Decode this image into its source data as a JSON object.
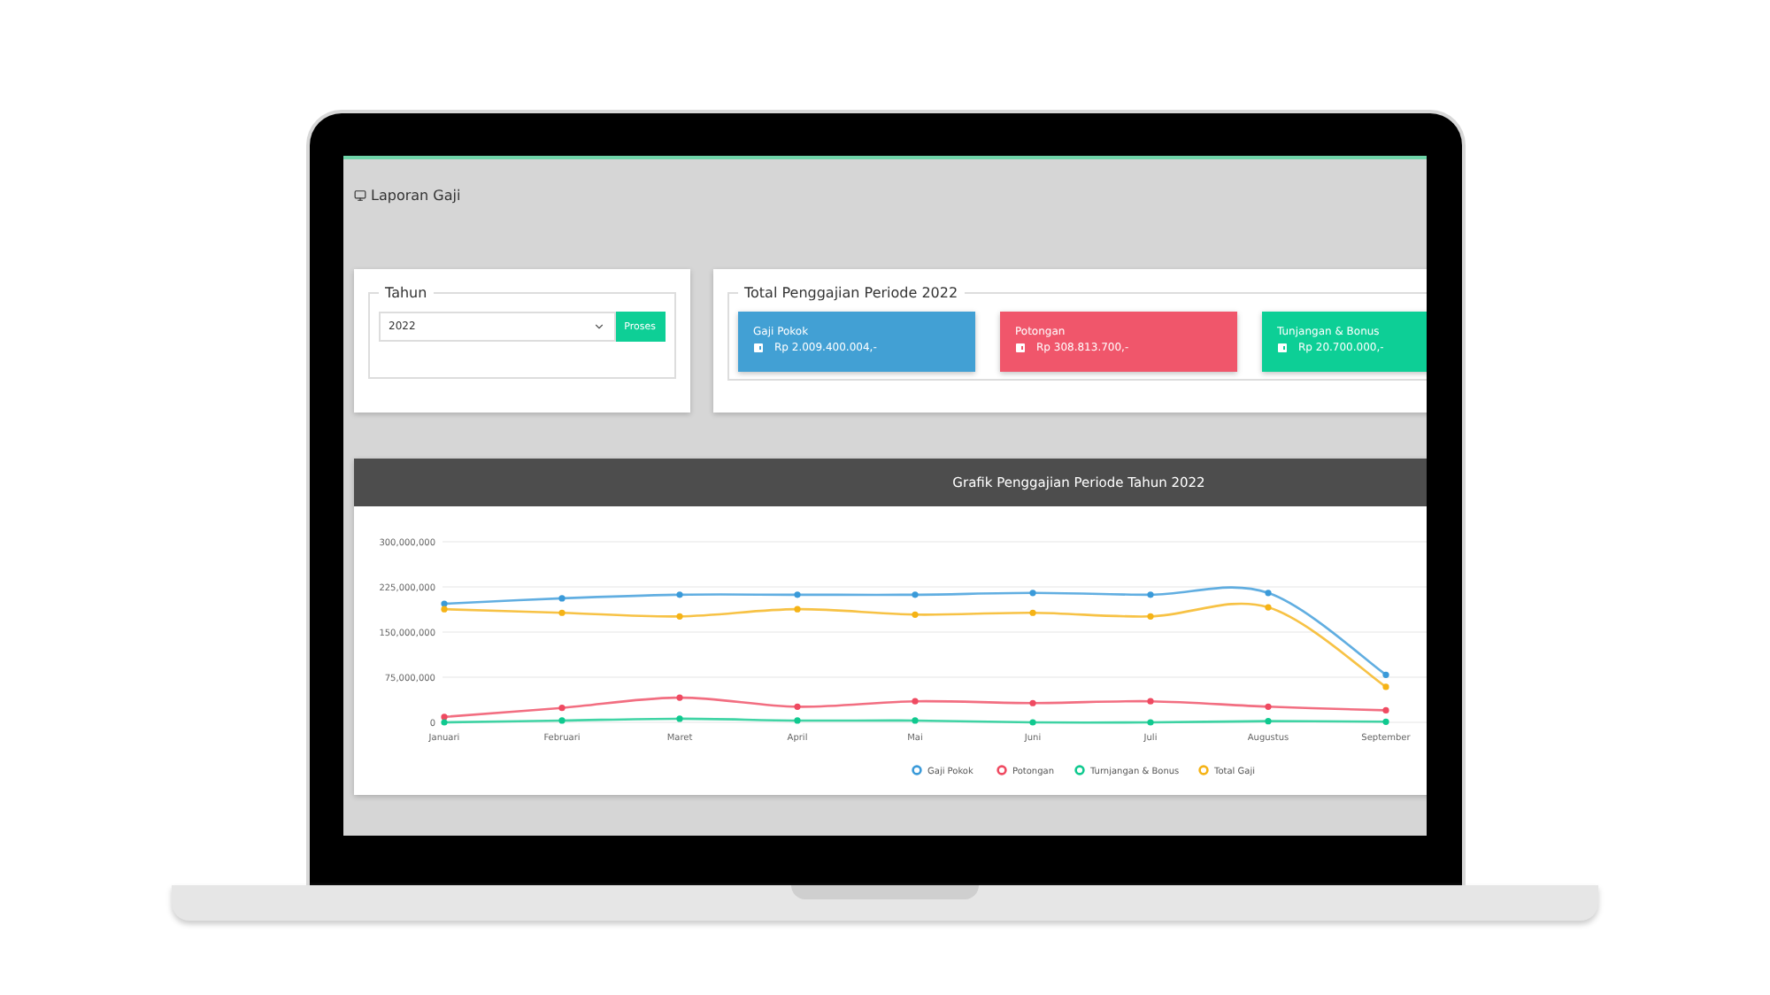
{
  "page": {
    "title": "Laporan Gaji"
  },
  "filter": {
    "legend": "Tahun",
    "year": "2022",
    "button": "Proses"
  },
  "summary": {
    "legend": "Total Penggajian Periode 2022",
    "cards": [
      {
        "label": "Gaji Pokok",
        "amount": "Rp 2.009.400.004,-",
        "color": "#42a0d4"
      },
      {
        "label": "Potongan",
        "amount": "Rp 308.813.700,-",
        "color": "#f0566b"
      },
      {
        "label": "Tunjangan & Bonus",
        "amount": "Rp 20.700.000,-",
        "color": "#0dcf96"
      }
    ]
  },
  "chart": {
    "title": "Grafik Penggajian Periode Tahun 2022",
    "chart_data": {
      "type": "line",
      "categories": [
        "Januari",
        "Februari",
        "Maret",
        "April",
        "Mai",
        "Juni",
        "Juli",
        "Augustus",
        "September"
      ],
      "ylim": [
        0,
        300000000
      ],
      "grid": true,
      "legend": true,
      "yticks": [
        {
          "value": 0,
          "label": "0"
        },
        {
          "value": 75000000,
          "label": "75,000,000"
        },
        {
          "value": 150000000,
          "label": "150,000,000"
        },
        {
          "value": 225000000,
          "label": "225,000,000"
        },
        {
          "value": 300000000,
          "label": "300,000,000"
        }
      ],
      "series": [
        {
          "name": "Gaji Pokok",
          "color": "#3a9ad9",
          "marker": "circle",
          "values": [
            197000000,
            206000000,
            212000000,
            212000000,
            212000000,
            215000000,
            212000000,
            215000000,
            79000000
          ]
        },
        {
          "name": "Potongan",
          "color": "#ef4a61",
          "marker": "circle",
          "values": [
            9000000,
            24000000,
            41000000,
            26000000,
            35000000,
            32000000,
            35000000,
            26000000,
            20000000
          ]
        },
        {
          "name": "Turnjangan & Bonus",
          "color": "#10c98f",
          "marker": "circle",
          "values": [
            0,
            3000000,
            6000000,
            3000000,
            3000000,
            0,
            0,
            2000000,
            1000000
          ]
        },
        {
          "name": "Total Gaji",
          "color": "#f5b316",
          "marker": "circle",
          "values": [
            188000000,
            182000000,
            176000000,
            188000000,
            179000000,
            182000000,
            176000000,
            191000000,
            59000000
          ]
        }
      ]
    }
  }
}
